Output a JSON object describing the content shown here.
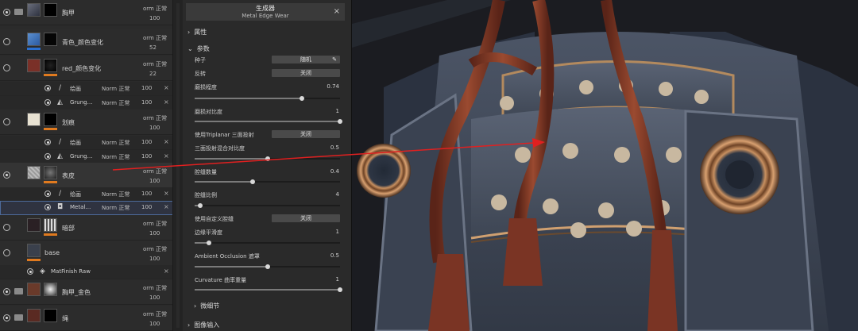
{
  "layers": {
    "groups": [
      {
        "name": "胸甲",
        "blend": "orm 正常",
        "opacity": "100"
      },
      {
        "name": "胸甲_金色",
        "blend": "orm 正常",
        "opacity": "100"
      },
      {
        "name": "绳",
        "blend": "orm 正常",
        "opacity": "100"
      }
    ],
    "items": [
      {
        "name": "青色_颜色变化",
        "blend": "orm 正常",
        "opacity": "52",
        "color": "#1f6fbf"
      },
      {
        "name": "red_颜色变化",
        "blend": "orm 正常",
        "opacity": "22",
        "color": "#e08020"
      },
      {
        "name": "划痕",
        "blend": "orm 正常",
        "opacity": "100",
        "color": "#e08020"
      },
      {
        "name": "表皮",
        "blend": "orm 正常",
        "opacity": "100",
        "color": "#e08020"
      },
      {
        "name": "暗部",
        "blend": "orm 正常",
        "opacity": "100",
        "color": "#e08020"
      },
      {
        "name": "base",
        "blend": "orm 正常",
        "opacity": "100",
        "color": "#e08020"
      }
    ],
    "sublayers": [
      {
        "name": "绘画",
        "blend": "Norm 正常",
        "opacity": "100"
      },
      {
        "name": "Grung…",
        "blend": "Norm 正常",
        "opacity": "100"
      },
      {
        "name": "绘画",
        "blend": "Norm 正常",
        "opacity": "100"
      },
      {
        "name": "Grung…",
        "blend": "Norm 正常",
        "opacity": "100"
      },
      {
        "name": "绘画",
        "blend": "Norm 正常",
        "opacity": "100"
      },
      {
        "name": "Metal…",
        "blend": "Norm 正常",
        "opacity": "100"
      }
    ],
    "effect": {
      "name": "MatFinish Raw"
    }
  },
  "props": {
    "title": "生成器",
    "subtitle": "Metal Edge Wear",
    "section_attr": "属性",
    "section_params": "参数",
    "section_fine": "微细节",
    "section_input": "图像输入",
    "seed_label": "种子",
    "seed_value": "随机",
    "invert_label": "反转",
    "invert_value": "关闭",
    "wear_level_label": "磨损程度",
    "wear_level_value": "0.74",
    "wear_level": 0.74,
    "wear_contrast_label": "磨损对比度",
    "wear_contrast_value": "1",
    "wear_contrast": 1,
    "triplanar_label": "使用Triplanar 三面投射",
    "triplanar_value": "关闭",
    "tri_blend_label": "三面投射混合对比度",
    "tri_blend_value": "0.5",
    "tri_blend": 0.5,
    "edge_amount_label": "腔缝数量",
    "edge_amount_value": "0.4",
    "edge_amount": 0.4,
    "edge_scale_label": "腔缝比例",
    "edge_scale_value": "4",
    "edge_scale": 0.04,
    "custom_edge_label": "使用自定义腔缝",
    "custom_edge_value": "关闭",
    "edge_smooth_label": "边缘平滑度",
    "edge_smooth_value": "1",
    "edge_smooth": 0.1,
    "ao_label": "Ambient Occlusion 遮罩",
    "ao_value": "0.5",
    "ao": 0.5,
    "curv_label": "Curvature 曲率重量",
    "curv_value": "1",
    "curv": 1
  },
  "colors": {
    "accent_arrow": "#e02020",
    "orange_bar": "#e07a1f",
    "blue_bar": "#2a6fd0"
  }
}
